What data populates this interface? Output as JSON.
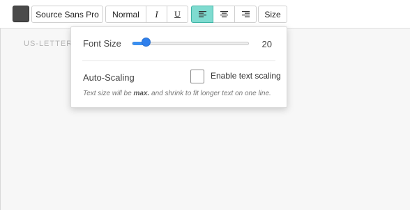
{
  "toolbar": {
    "color_swatch": "#4a4a4a",
    "font_family": "Source Sans Pro",
    "weight_label": "Normal",
    "italic_label": "I",
    "underline_label": "U",
    "align": [
      "align-left",
      "align-center",
      "align-right"
    ],
    "active_align": "align-left",
    "size_label": "Size"
  },
  "canvas": {
    "page_label": "US-LETTER -"
  },
  "size_popover": {
    "font_size_label": "Font Size",
    "font_size_value": "20",
    "slider_level": 0.12,
    "auto_scaling_label": "Auto-Scaling",
    "enable_scaling_label": "Enable text scaling",
    "enable_scaling_checked": false,
    "hint_prefix": "Text size will be ",
    "hint_bold": "max.",
    "hint_suffix": " and shrink to fit longer text on one line."
  },
  "colors": {
    "accent": "#2f80ed",
    "active_align_bg": "#7fdbd0"
  }
}
